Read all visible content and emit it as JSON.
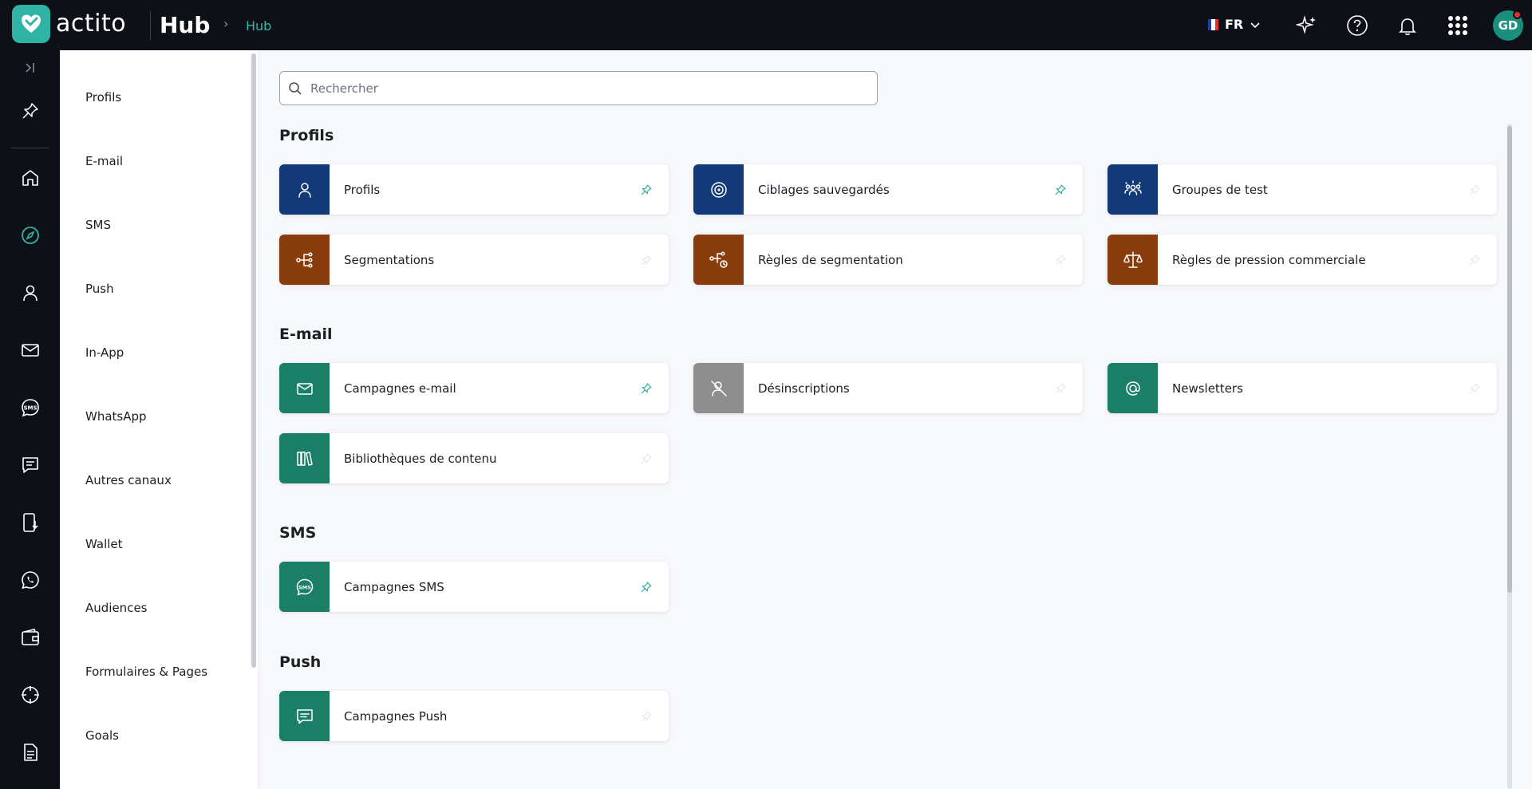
{
  "app": {
    "brand": "actito",
    "hub_title": "Hub",
    "breadcrumb": "Hub",
    "language": "FR",
    "avatar_initials": "GD"
  },
  "colors": {
    "blue": "#123a78",
    "brown": "#8a3d0c",
    "green": "#1a7f66",
    "grey": "#8e8e8e",
    "accent": "#2fb3a4"
  },
  "rail": {
    "icons": [
      "expand-icon",
      "pin-icon",
      "home-icon",
      "compass-icon",
      "user-icon",
      "mail-icon",
      "sms-icon",
      "chat-icon",
      "mobile-download-icon",
      "whatsapp-icon",
      "wallet-icon",
      "crosshair-icon",
      "document-icon"
    ]
  },
  "categories": [
    "Profils",
    "E-mail",
    "SMS",
    "Push",
    "In-App",
    "WhatsApp",
    "Autres canaux",
    "Wallet",
    "Audiences",
    "Formulaires & Pages",
    "Goals"
  ],
  "search": {
    "placeholder": "Rechercher"
  },
  "sections": [
    {
      "title": "Profils",
      "cards": [
        {
          "label": "Profils",
          "icon": "user-icon",
          "color": "blue",
          "pinned": true
        },
        {
          "label": "Ciblages sauvegardés",
          "icon": "target-icon",
          "color": "blue",
          "pinned": true
        },
        {
          "label": "Groupes de test",
          "icon": "group-icon",
          "color": "blue",
          "pinned": false
        },
        {
          "label": "Segmentations",
          "icon": "segment-icon",
          "color": "brown",
          "pinned": false
        },
        {
          "label": "Règles de segmentation",
          "icon": "segment-rule-icon",
          "color": "brown",
          "pinned": false
        },
        {
          "label": "Règles de pression commerciale",
          "icon": "scale-icon",
          "color": "brown",
          "pinned": false
        }
      ]
    },
    {
      "title": "E-mail",
      "cards": [
        {
          "label": "Campagnes e-mail",
          "icon": "mail-icon",
          "color": "green",
          "pinned": true
        },
        {
          "label": "Désinscriptions",
          "icon": "unsubscribe-icon",
          "color": "grey",
          "pinned": false
        },
        {
          "label": "Newsletters",
          "icon": "at-icon",
          "color": "green",
          "pinned": false
        },
        {
          "label": "Bibliothèques de contenu",
          "icon": "library-icon",
          "color": "green",
          "pinned": false
        }
      ]
    },
    {
      "title": "SMS",
      "cards": [
        {
          "label": "Campagnes SMS",
          "icon": "sms-icon",
          "color": "green",
          "pinned": true
        }
      ]
    },
    {
      "title": "Push",
      "cards": [
        {
          "label": "Campagnes Push",
          "icon": "chat-icon",
          "color": "green",
          "pinned": false
        }
      ]
    }
  ]
}
